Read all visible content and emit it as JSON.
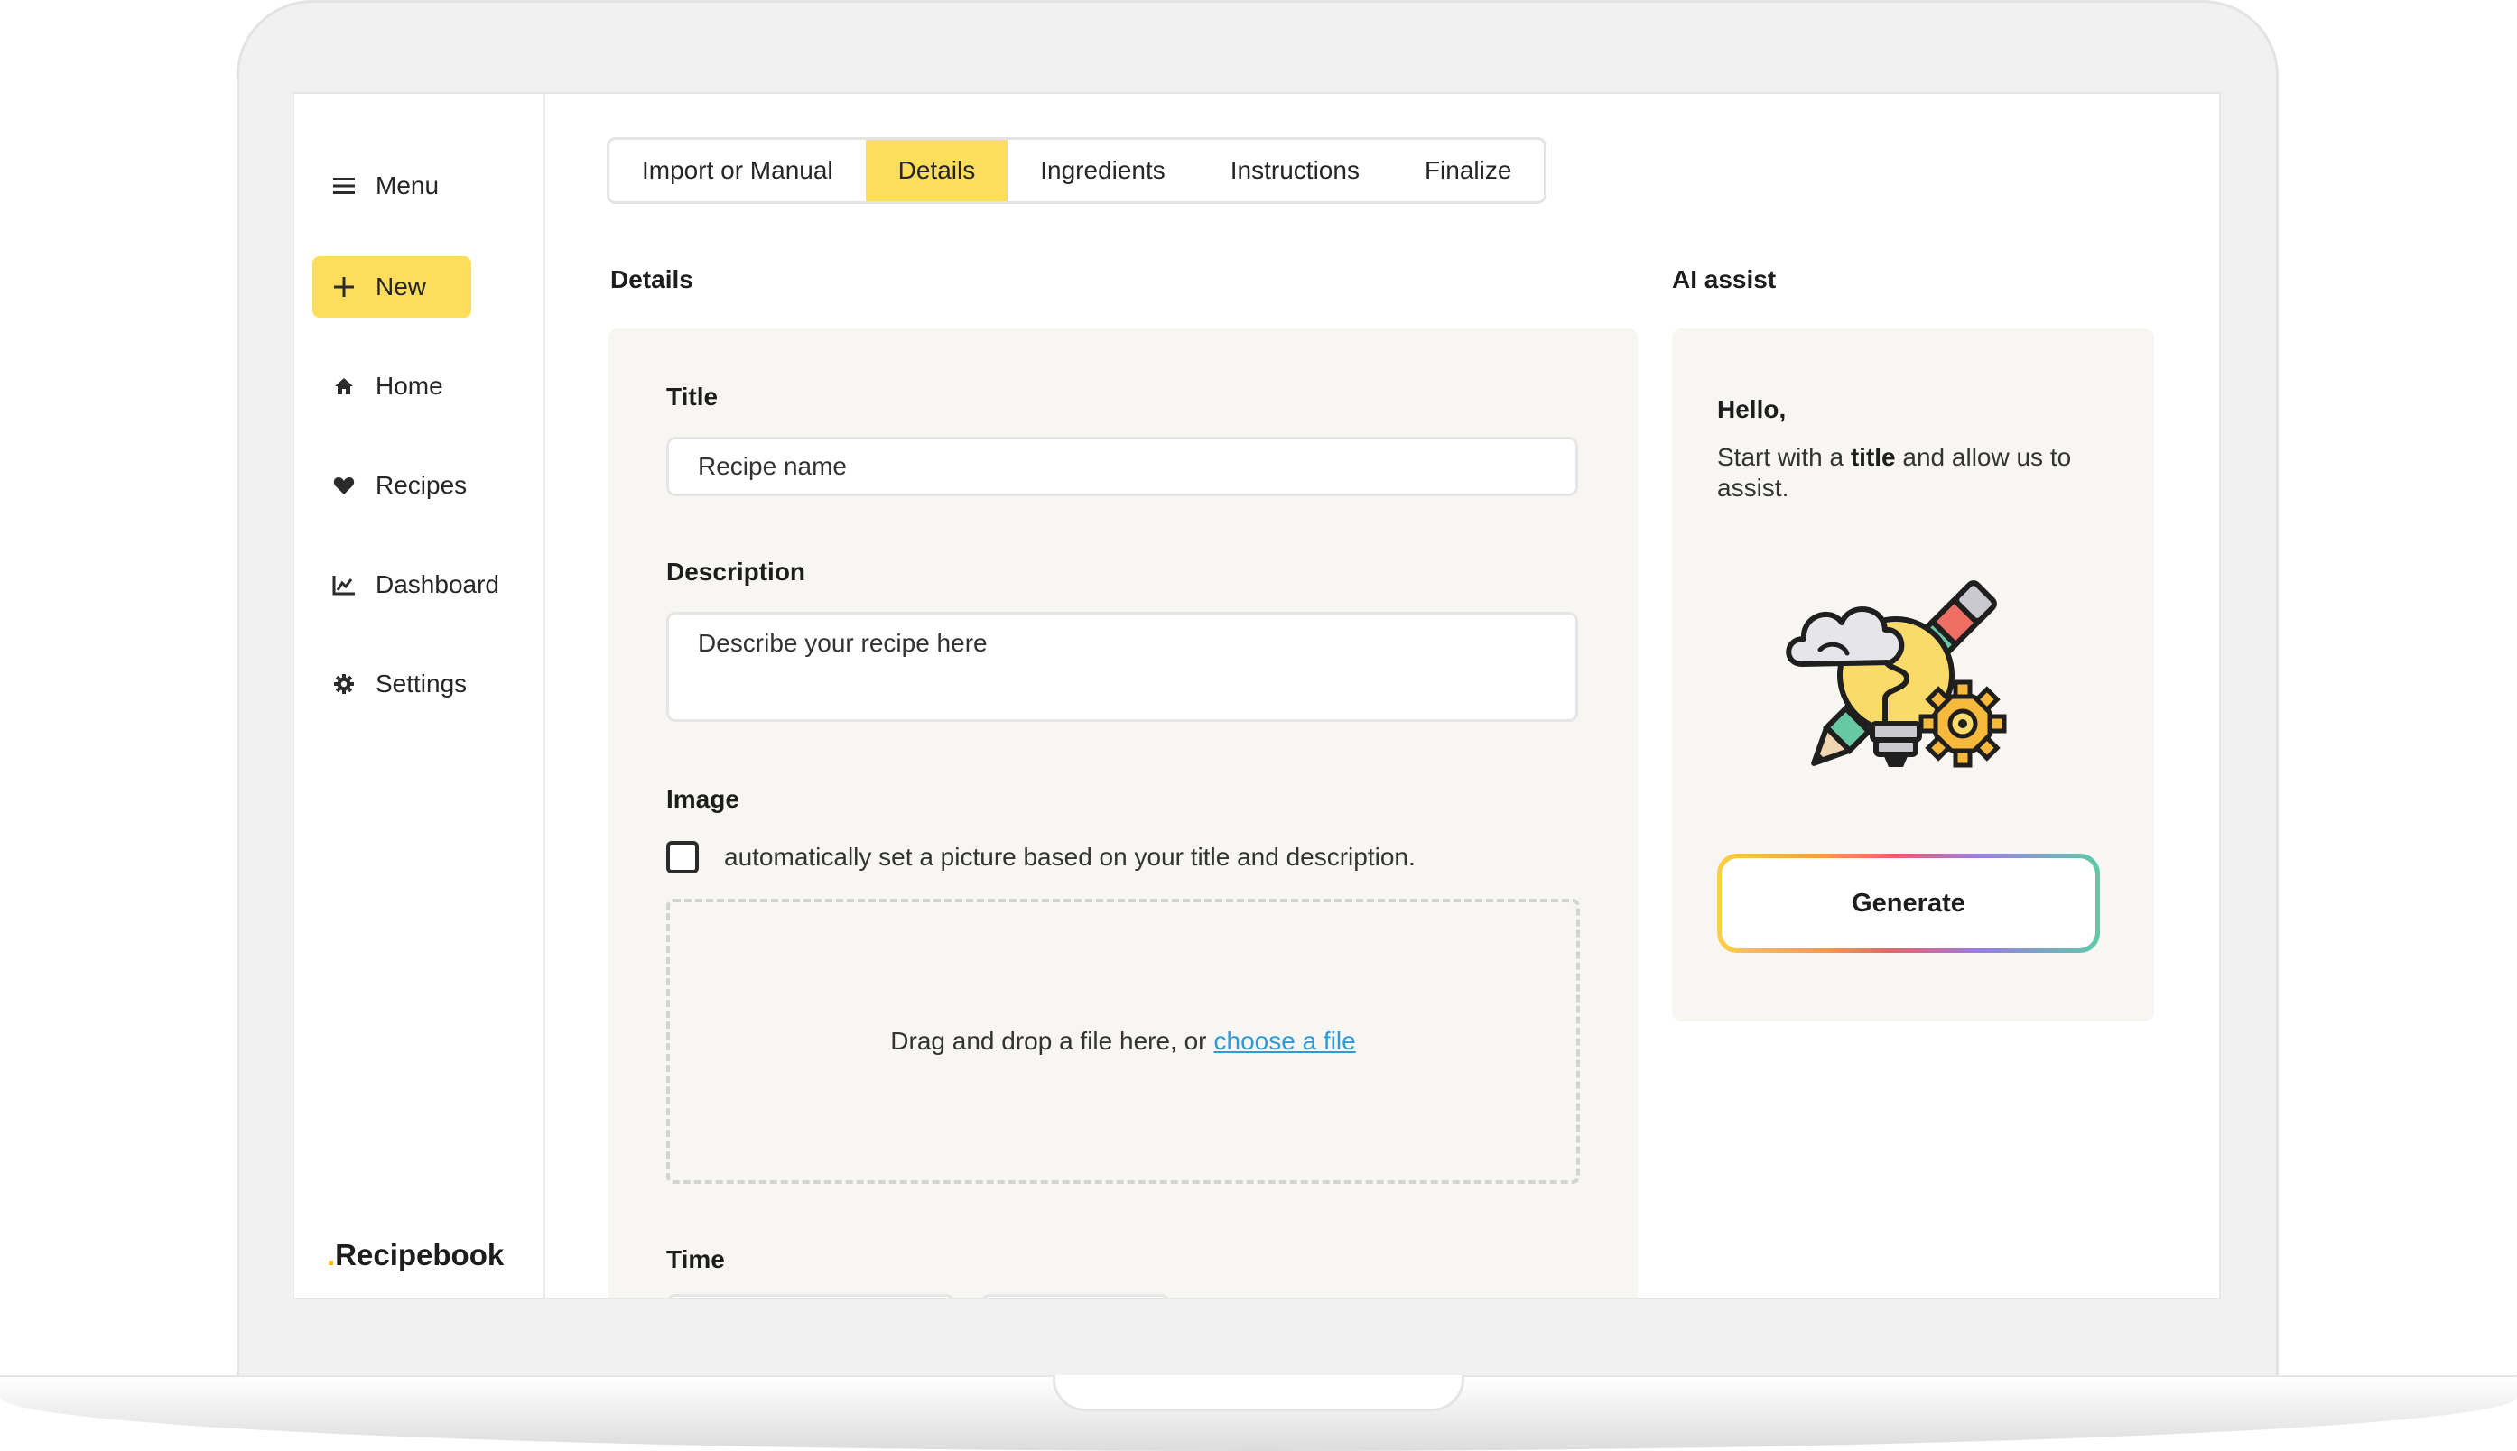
{
  "sidebar": {
    "items": [
      {
        "label": "Menu",
        "icon": "hamburger-icon"
      },
      {
        "label": "New",
        "icon": "plus-icon",
        "active": true
      },
      {
        "label": "Home",
        "icon": "home-icon"
      },
      {
        "label": "Recipes",
        "icon": "heart-icon"
      },
      {
        "label": "Dashboard",
        "icon": "chart-icon"
      },
      {
        "label": "Settings",
        "icon": "gear-icon"
      }
    ],
    "brand": {
      "dot": ".",
      "name": "Recipebook"
    }
  },
  "tabs": [
    {
      "label": "Import or Manual"
    },
    {
      "label": "Details",
      "active": true
    },
    {
      "label": "Ingredients"
    },
    {
      "label": "Instructions"
    },
    {
      "label": "Finalize"
    }
  ],
  "details": {
    "heading": "Details",
    "title_label": "Title",
    "title_placeholder": "Recipe name",
    "description_label": "Description",
    "description_placeholder": "Describe your recipe here",
    "image_label": "Image",
    "auto_image_text": "automatically set a picture based on your title and description.",
    "auto_image_checked": false,
    "dropzone_text": "Drag and drop a file here, or",
    "dropzone_link": "choose a file",
    "time_label": "Time"
  },
  "ai_assist": {
    "heading": "AI assist",
    "greeting": "Hello,",
    "text_before": "Start with a ",
    "text_bold": "title",
    "text_after": " and allow us to assist.",
    "illustration_icon": "idea-lightbulb-pencil-gear-icon",
    "generate_label": "Generate"
  },
  "colors": {
    "accent": "#fddd5c",
    "link": "#2e9bd6",
    "panel_bg": "#f7f6f2"
  }
}
